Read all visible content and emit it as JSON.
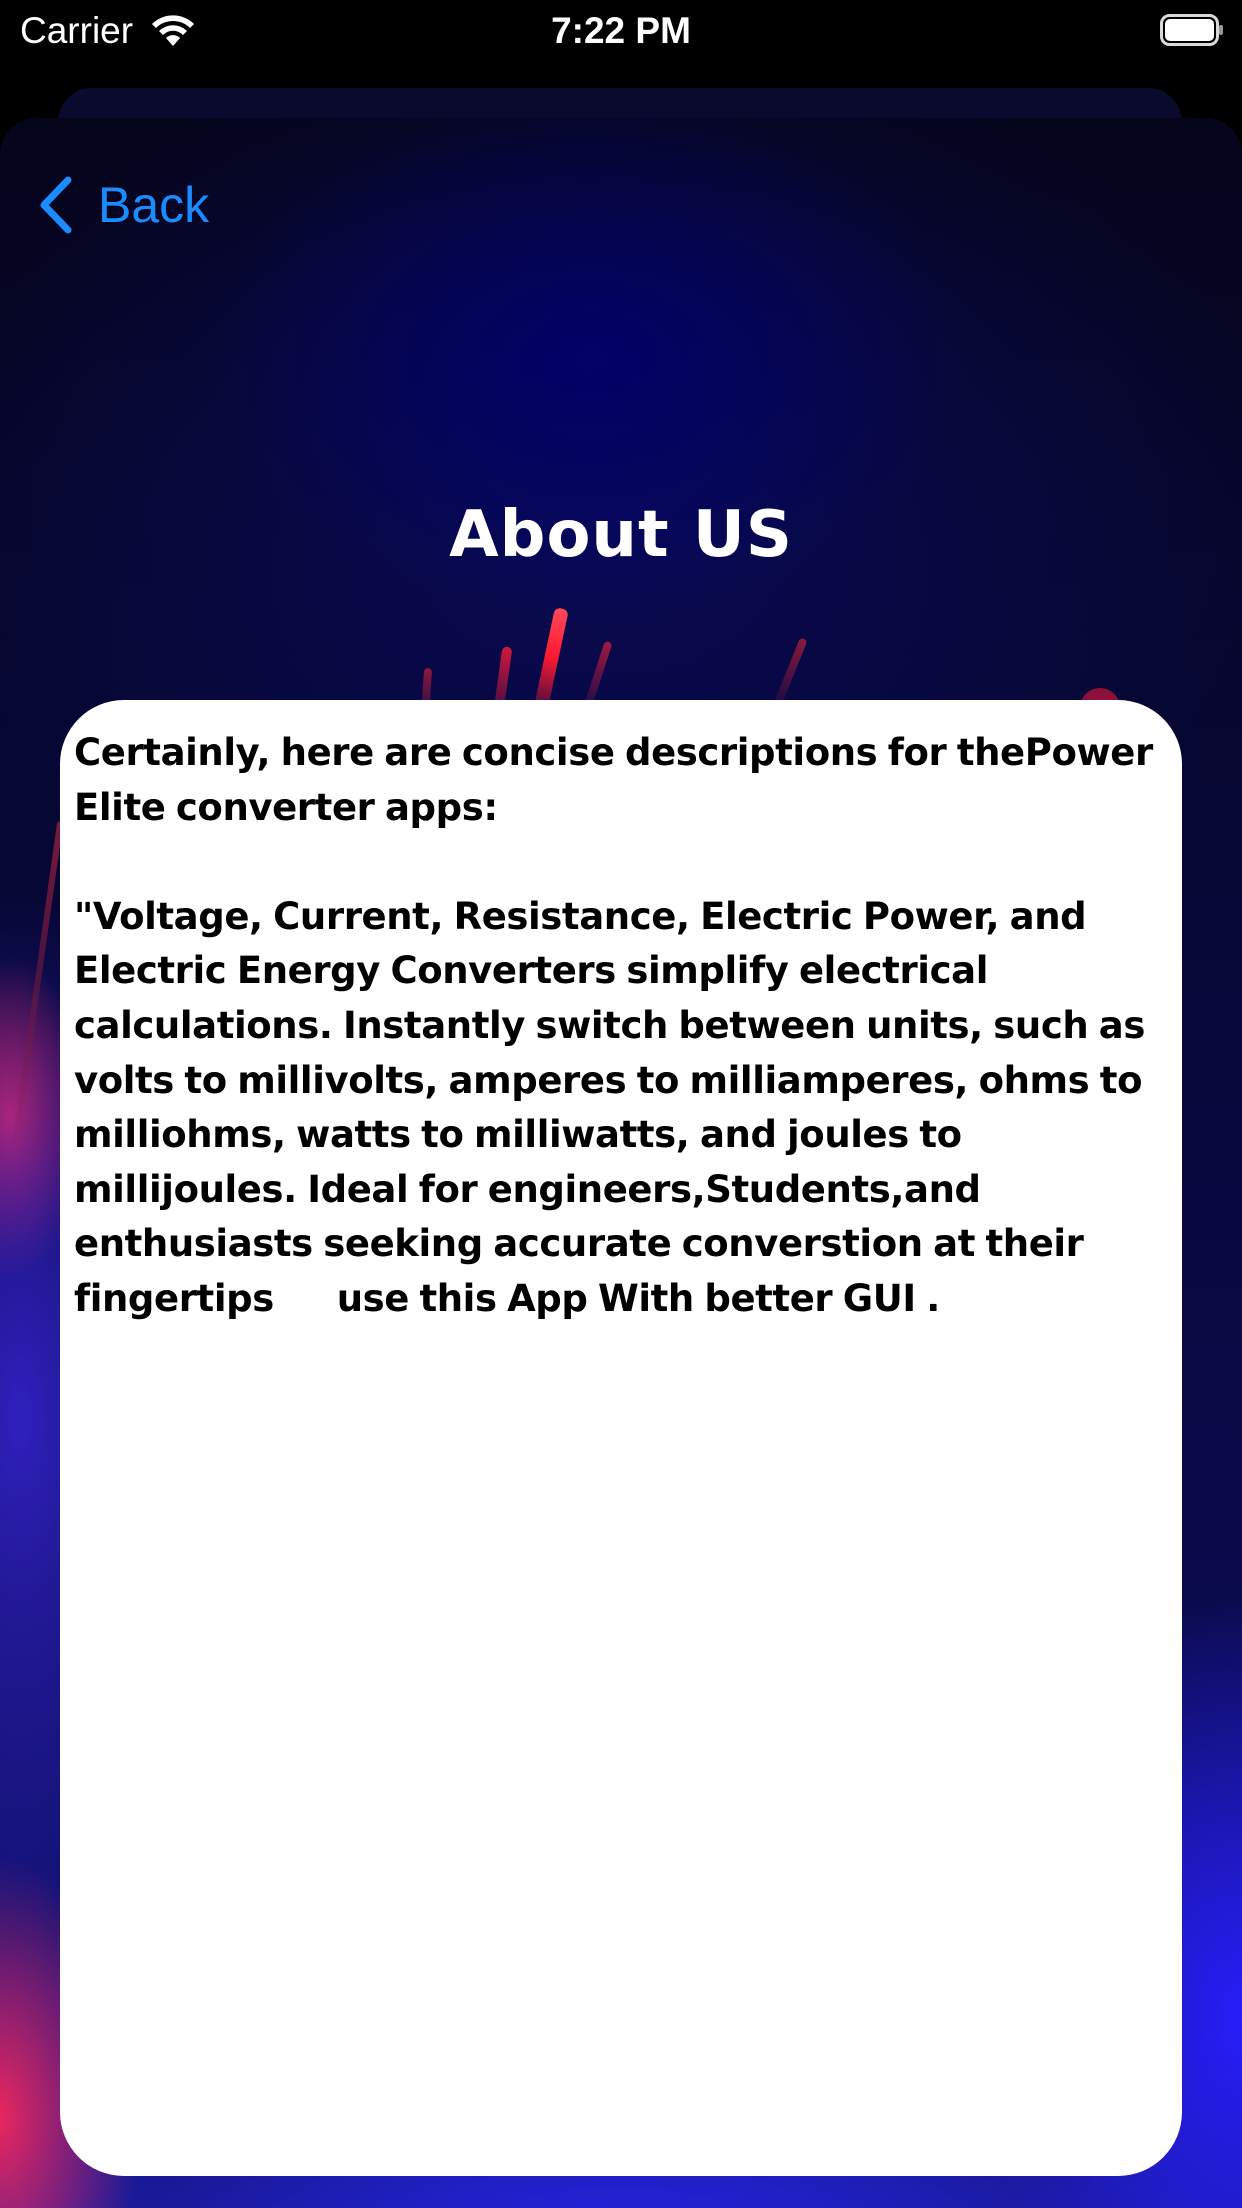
{
  "status_bar": {
    "carrier": "Carrier",
    "time": "7:22 PM",
    "icons": [
      "wifi-icon",
      "battery-icon"
    ]
  },
  "nav": {
    "back_label": "Back",
    "back_icon": "chevron-left-icon",
    "accent_color": "#1a8cff"
  },
  "page": {
    "title": "About US"
  },
  "content": {
    "paragraphs": [
      "Certainly, here are concise descriptions for thePower Elite converter apps:",
      "\"Voltage, Current, Resistance, Electric Power, and Electric Energy Converters simplify electrical calculations. Instantly switch between units, such as volts to millivolts, amperes to milliamperes, ohms to milliohms, watts to milliwatts, and joules to millijoules. Ideal for engineers,Students,and enthusiasts seeking accurate converstion at their fingertips      use this App With better GUI ."
    ],
    "card_color": "#ffffff",
    "text_color": "#000000"
  }
}
